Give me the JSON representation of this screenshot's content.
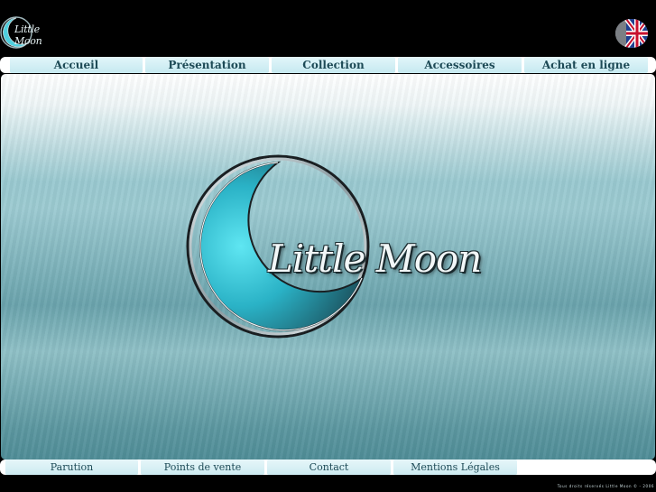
{
  "header": {
    "logo_text": "Little Moon",
    "language_flag": "uk-flag-icon"
  },
  "nav": {
    "items": [
      {
        "label": "Accueil"
      },
      {
        "label": "Présentation"
      },
      {
        "label": "Collection"
      },
      {
        "label": "Accessoires"
      },
      {
        "label": "Achat en ligne"
      }
    ]
  },
  "main": {
    "brand_text": "Little Moon",
    "moon_icon": "crescent-moon-icon"
  },
  "footer": {
    "items": [
      {
        "label": "Parution"
      },
      {
        "label": "Points de vente"
      },
      {
        "label": "Contact"
      },
      {
        "label": "Mentions Légales"
      }
    ],
    "copyright": "Tous droits réservés Little Moon © - 2006"
  },
  "colors": {
    "nav_bg": "#c6e9f0",
    "nav_text": "#1d4a56",
    "main_teal": "#6aa3ac"
  }
}
